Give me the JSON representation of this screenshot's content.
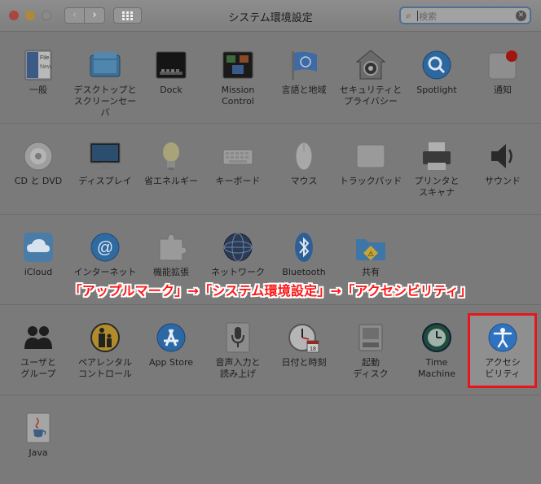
{
  "window": {
    "title": "システム環境設定",
    "back_glyph": "‹",
    "forward_glyph": "›"
  },
  "search": {
    "placeholder": "検索"
  },
  "rows": {
    "personal": [
      {
        "label": "一般",
        "icon": "general-icon"
      },
      {
        "label": "デスクトップと\nスクリーンセーバ",
        "icon": "desktop-icon"
      },
      {
        "label": "Dock",
        "icon": "dock-icon"
      },
      {
        "label": "Mission\nControl",
        "icon": "mission-control-icon"
      },
      {
        "label": "言語と地域",
        "icon": "language-region-icon"
      },
      {
        "label": "セキュリティと\nプライバシー",
        "icon": "security-icon"
      },
      {
        "label": "Spotlight",
        "icon": "spotlight-icon"
      },
      {
        "label": "通知",
        "icon": "notifications-icon"
      }
    ],
    "hardware": [
      {
        "label": "CD と DVD",
        "icon": "cd-dvd-icon"
      },
      {
        "label": "ディスプレイ",
        "icon": "display-icon"
      },
      {
        "label": "省エネルギー",
        "icon": "energy-saver-icon"
      },
      {
        "label": "キーボード",
        "icon": "keyboard-icon"
      },
      {
        "label": "マウス",
        "icon": "mouse-icon"
      },
      {
        "label": "トラックパッド",
        "icon": "trackpad-icon"
      },
      {
        "label": "プリンタと\nスキャナ",
        "icon": "printer-icon"
      },
      {
        "label": "サウンド",
        "icon": "sound-icon"
      }
    ],
    "internet": [
      {
        "label": "iCloud",
        "icon": "icloud-icon"
      },
      {
        "label": "インターネット",
        "icon": "internet-accounts-icon"
      },
      {
        "label": "機能拡張",
        "icon": "extensions-icon"
      },
      {
        "label": "ネットワーク",
        "icon": "network-icon"
      },
      {
        "label": "Bluetooth",
        "icon": "bluetooth-icon"
      },
      {
        "label": "共有",
        "icon": "sharing-icon"
      }
    ],
    "system": [
      {
        "label": "ユーザと\nグループ",
        "icon": "users-icon"
      },
      {
        "label": "ペアレンタル\nコントロール",
        "icon": "parental-icon"
      },
      {
        "label": "App Store",
        "icon": "app-store-icon"
      },
      {
        "label": "音声入力と\n読み上げ",
        "icon": "dictation-icon"
      },
      {
        "label": "日付と時刻",
        "icon": "date-time-icon"
      },
      {
        "label": "起動\nディスク",
        "icon": "startup-disk-icon"
      },
      {
        "label": "Time\nMachine",
        "icon": "time-machine-icon"
      },
      {
        "label": "アクセシ\nビリティ",
        "icon": "accessibility-icon"
      }
    ],
    "other": [
      {
        "label": "Java",
        "icon": "java-icon"
      }
    ]
  },
  "caption": "「アップルマーク」→「システム環境設定」→「アクセシビリティ」",
  "colors": {
    "background": "#7a7a7a",
    "highlight_border": "#e8151c",
    "caption_text": "#ff1515"
  }
}
